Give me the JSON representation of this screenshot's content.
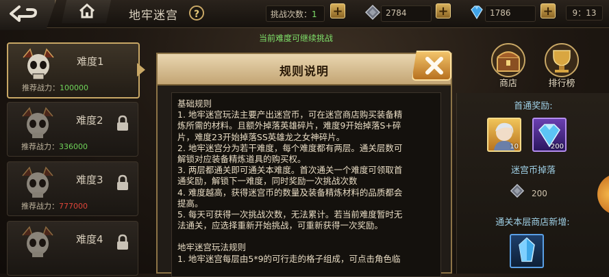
{
  "header": {
    "title": "地牢迷宫",
    "help_label": "?",
    "challenge_label": "挑战次数：",
    "challenge_value": "1",
    "currency1": "2784",
    "currency2": "1786",
    "time": "9：13",
    "notice": "当前难度可继续挑战"
  },
  "difficulties": [
    {
      "name": "难度1",
      "power_label": "推荐战力：",
      "power": "100000",
      "power_color": "#6fd45a",
      "locked": false
    },
    {
      "name": "难度2",
      "power_label": "推荐战力：",
      "power": "336000",
      "power_color": "#6fd45a",
      "locked": true
    },
    {
      "name": "难度3",
      "power_label": "推荐战力：",
      "power": "777000",
      "power_color": "#e0453a",
      "locked": true
    },
    {
      "name": "难度4",
      "power_label": "",
      "power": "",
      "power_color": "#6fd45a",
      "locked": true
    }
  ],
  "right": {
    "shop_label": "商店",
    "rank_label": "排行榜",
    "first_reward_title": "首通奖励:",
    "reward_counts": [
      "10",
      "200"
    ],
    "coin_drop_title": "迷宫币掉落",
    "coin_drop_value": "200",
    "new_items_title": "通关本层商店新增:"
  },
  "modal": {
    "title": "规则说明",
    "close_icon": "close-x-icon",
    "lines": [
      "基础规则",
      "1. 地牢迷宫玩法主要产出迷宫币，可在迷宫商店购买装备精",
      "炼所需的材料。且额外掉落英雄碎片，难度9开始掉落S+碎",
      "片，难度23开始掉落SS英雄龙之女神碎片。",
      "2. 地牢迷宫分为若干难度，每个难度都有两层。通关层数可",
      "解锁对应装备精炼道具的购买权。",
      "3. 两层都通关即可通关本难度。首次通关一个难度可领取首",
      "通奖励，解锁下一难度，同时奖励一次挑战次数",
      "4. 难度越高，获得迷宫币的数量及装备精炼材料的品质都会",
      "提高。",
      "5. 每天可获得一次挑战次数，无法累计。若当前难度暂时无",
      "法通关，应选择重新开始挑战，可重新获得一次奖励。",
      "",
      "地牢迷宫玩法规则",
      "1. 地牢迷宫每层由5*9的可行走的格子组成，可点击角色临"
    ]
  }
}
